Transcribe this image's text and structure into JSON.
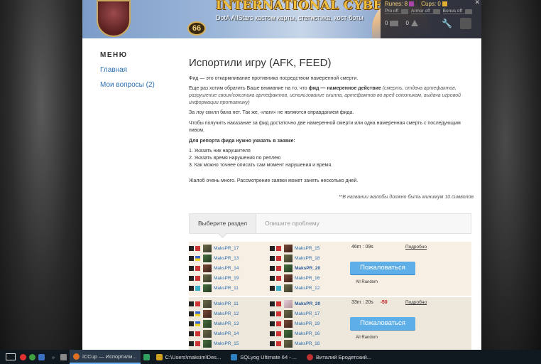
{
  "header": {
    "brand": "INTERNATIONAL CYBER CUP",
    "tagline": "DotA AllStars кастом карты, статистика, хост-боты",
    "level": "66",
    "stats": {
      "runes_label": "Runes: 8",
      "cups_label": "Cups: 0",
      "toggles": [
        "Pro off",
        "Armor off",
        "Bonus off"
      ],
      "messages_count": "0",
      "alerts_count": "0"
    }
  },
  "sidebar": {
    "title": "МЕНЮ",
    "items": [
      {
        "label": "Главная"
      },
      {
        "label": "Мои вопросы (2)"
      }
    ]
  },
  "content": {
    "title": "Испортили игру (AFK, FEED)",
    "p1": "Фид — это откармливание противника посредством намеренной смерти.",
    "p2_a": "Еще раз хотим обратить Ваше внимание на то, что ",
    "p2_b": "фид — намеренное действие",
    "p2_c": " (смерть, отдача артефактов, разрушение своих/союзника артефактов, использование скилла, артефактов во вред союзникам, выдача игровой информации противнику)",
    "p3": "За лоу скилл бана нет. Так же, «лаги» не являются оправданием фида.",
    "p4": "Чтобы получить наказание за фид достаточно две намеренной смерти или одна намеренная смерть с последующим пивом.",
    "req_title": "Для репорта фида нужно указать в заявке:",
    "req_items": [
      "1. Указать ник нарушителя",
      "2. Указать время нарушения по реплею",
      "3. Как можно точнее описать сам момент нарушения и время."
    ],
    "p5": "Жалоб очень много. Рассмотрение заявки может занять несколько дней.",
    "note": "**В названии жалобы должно быть минимум 10 символов"
  },
  "tabs": [
    {
      "label": "Выберите раздел"
    },
    {
      "label": "Опишите проблему"
    }
  ],
  "matches": [
    {
      "team1": [
        "MaksPR_17",
        "MaksPR_13",
        "MaksPR_14",
        "MaksPR_19",
        "MaksPR_11"
      ],
      "team2": [
        "MaksPR_15",
        "MaksPR_18",
        "MaksPR_20",
        "MaksPR_16",
        "MaksPR_12"
      ],
      "time": "46m : 09s",
      "delta": "",
      "replay": "Подробно",
      "report": "Пожаловаться",
      "mode": "All Random"
    },
    {
      "team1": [
        "MaksPR_11",
        "MaksPR_12",
        "MaksPR_13",
        "MaksPR_14",
        "MaksPR_15"
      ],
      "team2": [
        "MaksPR_20",
        "MaksPR_17",
        "MaksPR_19",
        "MaksPR_16",
        "MaksPR_18"
      ],
      "time": "33m : 20s",
      "delta": "-50",
      "replay": "Подробно",
      "report": "Пожаловаться",
      "mode": "All Random"
    }
  ],
  "taskbar": {
    "items": [
      {
        "label": "iCCup — Испортили..."
      },
      {
        "label": "C:\\Users\\maksim\\Des..."
      },
      {
        "label": "SQLyog Ultimate 64 - ..."
      },
      {
        "label": "Виталий Бродетский..."
      }
    ]
  }
}
